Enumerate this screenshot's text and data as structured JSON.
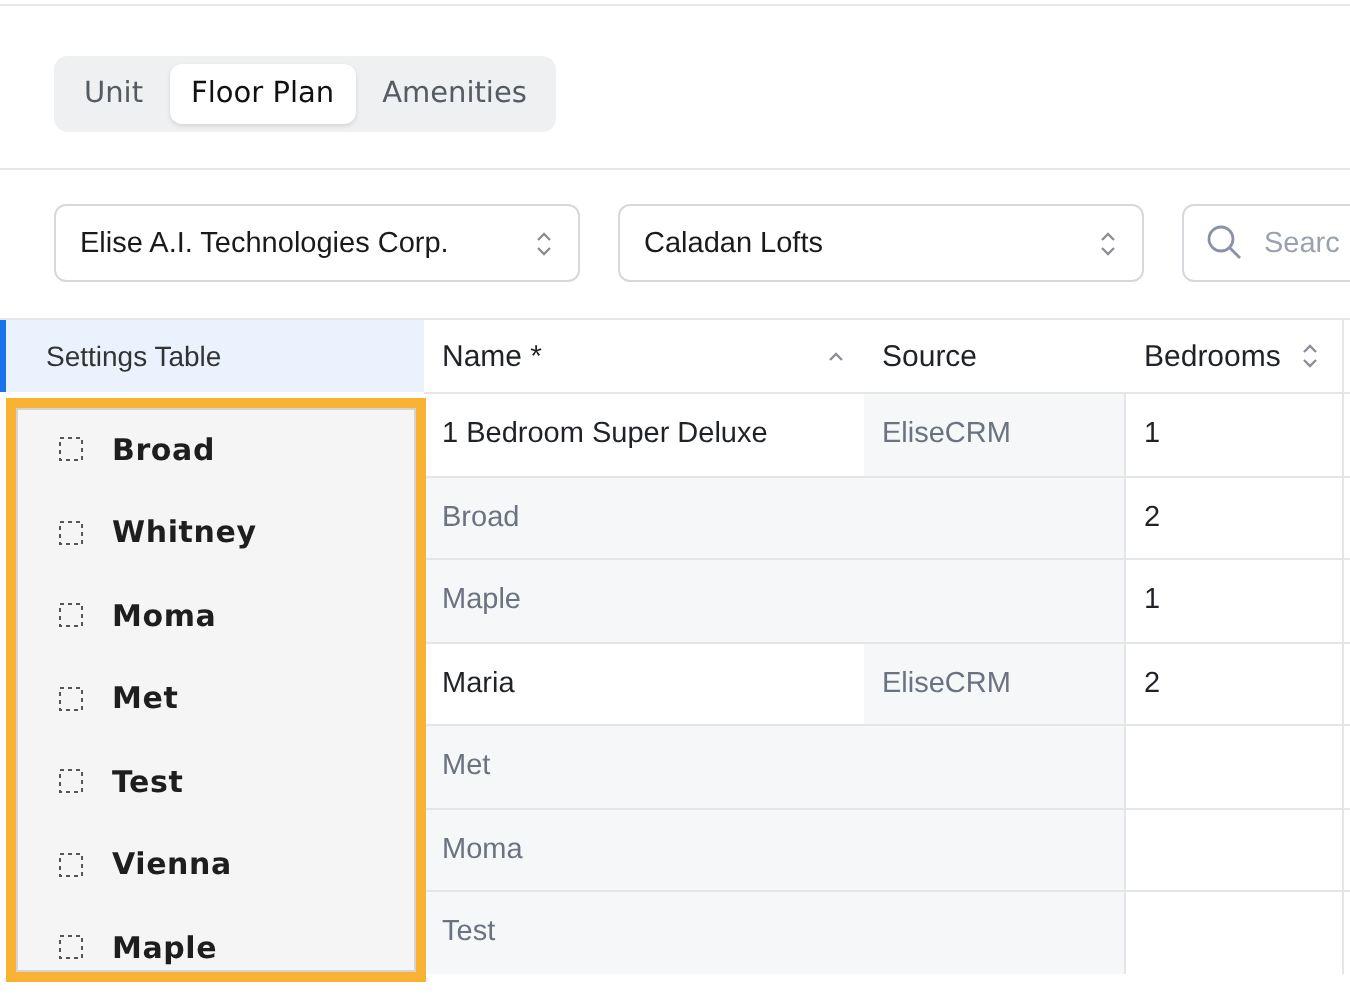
{
  "tabs": [
    {
      "label": "Unit",
      "selected": false
    },
    {
      "label": "Floor Plan",
      "selected": true
    },
    {
      "label": "Amenities",
      "selected": false
    }
  ],
  "filters": [
    {
      "kind": "select",
      "value": "Elise A.I. Technologies Corp."
    },
    {
      "kind": "select",
      "value": "Caladan Lofts"
    },
    {
      "kind": "search",
      "placeholder": "Searc"
    }
  ],
  "sidebar": {
    "title": "Settings Table",
    "selected": true
  },
  "drag_list": {
    "items": [
      "Broad",
      "Whitney",
      "Moma",
      "Met",
      "Test",
      "Vienna",
      "Maple"
    ]
  },
  "table": {
    "columns": [
      {
        "label": "Name *",
        "sorted": true
      },
      {
        "label": "Source",
        "sortable": false,
        "sorted": false
      },
      {
        "label": "Bedrooms",
        "sortable": true,
        "sorted": false
      }
    ],
    "rows": [
      {
        "cells": [
          "1 Bedroom Super Deluxe",
          "EliseCRM",
          "1"
        ],
        "disabled": false
      },
      {
        "cells": [
          "Broad",
          "",
          "2"
        ],
        "disabled": true
      },
      {
        "cells": [
          "Maple",
          "",
          "1"
        ],
        "disabled": true
      },
      {
        "cells": [
          "Maria",
          "EliseCRM",
          "2"
        ],
        "disabled": false
      },
      {
        "cells": [
          "Met",
          "",
          ""
        ],
        "disabled": true
      },
      {
        "cells": [
          "Moma",
          "",
          ""
        ],
        "disabled": true
      },
      {
        "cells": [
          "Test",
          "",
          ""
        ],
        "disabled": true
      }
    ]
  }
}
